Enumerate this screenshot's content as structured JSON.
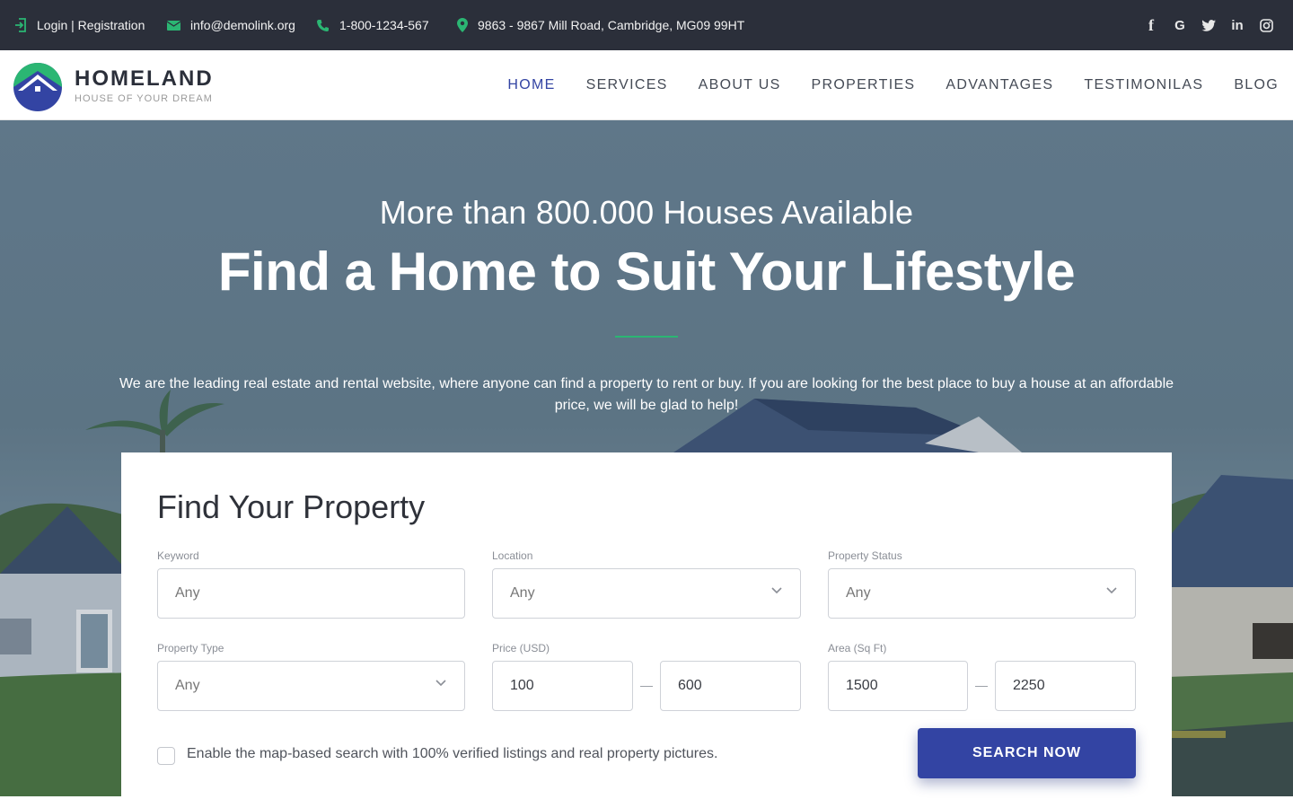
{
  "colors": {
    "topbar_bg": "#2b2f3a",
    "accent_green": "#2bb673",
    "brand_blue": "#3344a3",
    "nav_text": "#444a55"
  },
  "topbar": {
    "login": {
      "icon": "login-icon",
      "label": "Login | Registration"
    },
    "email": {
      "icon": "envelope-icon",
      "label": "info@demolink.org"
    },
    "phone": {
      "icon": "phone-icon",
      "label": "1-800-1234-567"
    },
    "address": {
      "icon": "location-pin-icon",
      "label": "9863 - 9867 Mill Road, Cambridge, MG09 99HT"
    },
    "social": [
      {
        "icon": "facebook-icon",
        "glyph": "f"
      },
      {
        "icon": "google-icon",
        "glyph": "G"
      },
      {
        "icon": "twitter-icon",
        "glyph": "t"
      },
      {
        "icon": "linkedin-icon",
        "glyph": "in"
      },
      {
        "icon": "instagram-icon",
        "glyph": "◎"
      }
    ]
  },
  "header": {
    "brand_name": "HOMELAND",
    "tagline": "HOUSE OF YOUR DREAM",
    "nav": [
      {
        "label": "HOME",
        "active": true
      },
      {
        "label": "SERVICES"
      },
      {
        "label": "ABOUT US"
      },
      {
        "label": "PROPERTIES"
      },
      {
        "label": "ADVANTAGES"
      },
      {
        "label": "TESTIMONILAS"
      },
      {
        "label": "BLOG"
      }
    ]
  },
  "hero": {
    "subtitle": "More than 800.000 Houses Available",
    "title": "Find a Home to Suit Your Lifestyle",
    "description": "We are the leading real estate and rental website, where anyone can find a property to rent or buy. If you are looking for the best place to buy a house at an affordable price, we will be glad to help!"
  },
  "search": {
    "title": "Find Your Property",
    "keyword": {
      "label": "Keyword",
      "placeholder": "Any"
    },
    "location": {
      "label": "Location",
      "value": "Any"
    },
    "property_status": {
      "label": "Property Status",
      "value": "Any"
    },
    "property_type": {
      "label": "Property Type",
      "value": "Any"
    },
    "price": {
      "label": "Price (USD)",
      "min": "100",
      "max": "600"
    },
    "area": {
      "label": "Area (Sq Ft)",
      "min": "1500",
      "max": "2250"
    },
    "map_checkbox": {
      "label": "Enable the map-based search with 100% verified listings and real property pictures.",
      "checked": false
    },
    "submit_label": "SEARCH NOW"
  }
}
